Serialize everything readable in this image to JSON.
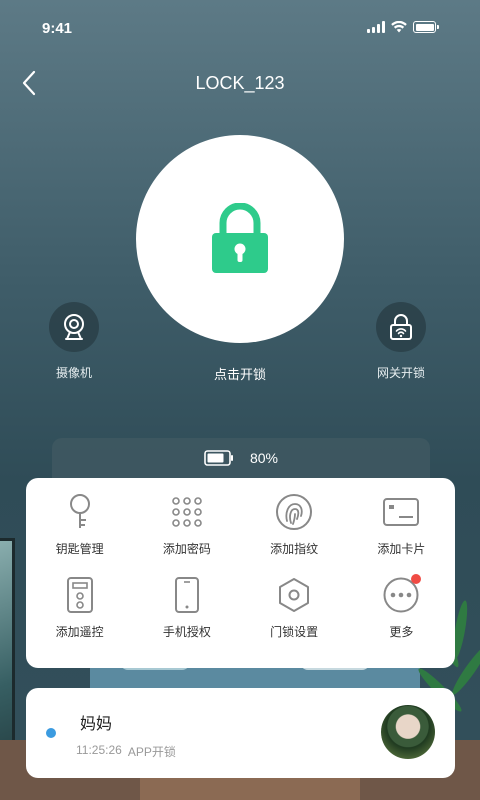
{
  "status_bar": {
    "time": "9:41"
  },
  "header": {
    "title": "LOCK_123"
  },
  "lock": {
    "label": "点击开锁",
    "color": "#2ecb8b"
  },
  "side": {
    "camera_label": "摄像机",
    "gateway_label": "网关开锁"
  },
  "battery": {
    "percent": "80%",
    "level": 0.8
  },
  "menu": {
    "items": [
      {
        "label": "钥匙管理",
        "icon": "key-icon"
      },
      {
        "label": "添加密码",
        "icon": "keypad-icon"
      },
      {
        "label": "添加指纹",
        "icon": "fingerprint-icon"
      },
      {
        "label": "添加卡片",
        "icon": "card-icon"
      },
      {
        "label": "添加遥控",
        "icon": "remote-icon"
      },
      {
        "label": "手机授权",
        "icon": "phone-icon"
      },
      {
        "label": "门锁设置",
        "icon": "settings-hex-icon"
      },
      {
        "label": "更多",
        "icon": "more-icon",
        "badge": true
      }
    ]
  },
  "log": {
    "name": "妈妈",
    "time": "11:25:26",
    "method": "APP开锁",
    "dot_color": "#3b9be0"
  }
}
